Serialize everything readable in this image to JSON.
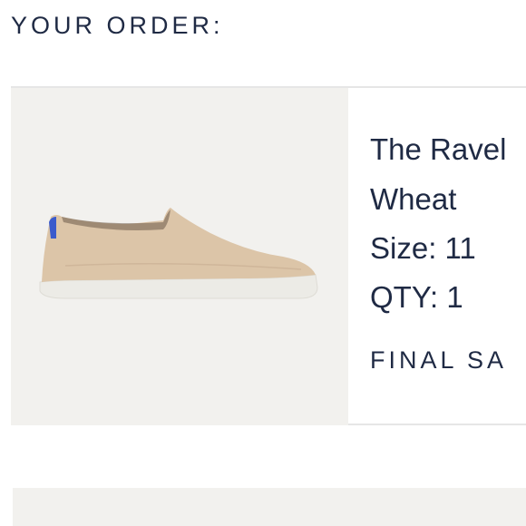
{
  "order": {
    "heading": "YOUR ORDER:"
  },
  "item": {
    "name": "The Ravel",
    "color": "Wheat",
    "size": "Size: 11",
    "qty": "QTY: 1",
    "final_sale": "FINAL SA",
    "image_subject": "slip-on-shoe-icon",
    "image_colors": {
      "background": "#f2f1ee",
      "upper": "#dcc5a8",
      "sole": "#ecebe6",
      "heel_tab": "#3b5bcc"
    }
  },
  "colors": {
    "text": "#1f2a44",
    "divider": "#e6e6e6"
  }
}
